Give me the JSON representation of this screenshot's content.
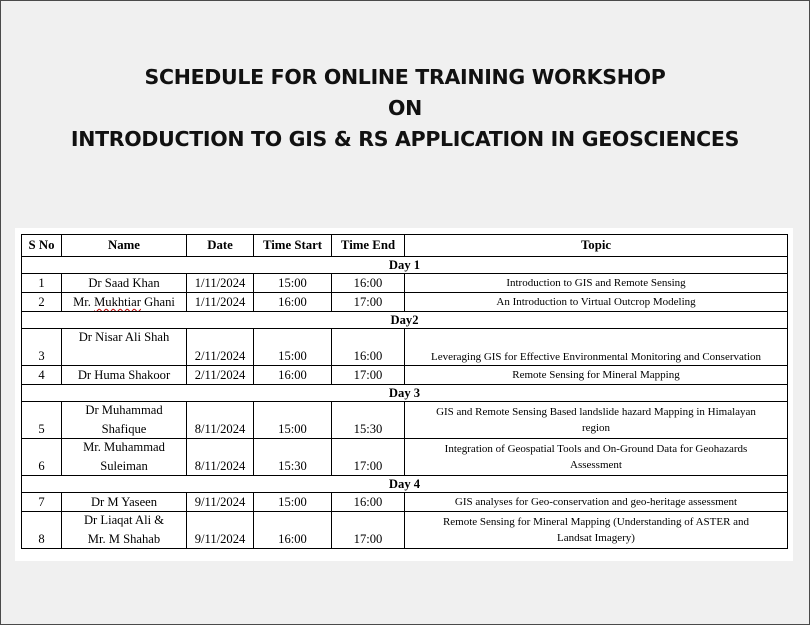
{
  "title": {
    "line1": "SCHEDULE FOR ONLINE TRAINING WORKSHOP",
    "line2": "ON",
    "line3": "INTRODUCTION TO GIS & RS APPLICATION IN GEOSCIENCES"
  },
  "table": {
    "headers": [
      "S No",
      "Name",
      "Date",
      "Time Start",
      "Time End",
      "Topic"
    ],
    "days": [
      "Day 1",
      "Day2",
      "Day 3",
      "Day 4"
    ],
    "rows": [
      {
        "sno": "1",
        "name": "Dr Saad Khan",
        "date": "1/11/2024",
        "start": "15:00",
        "end": "16:00",
        "topic": "Introduction to GIS and Remote Sensing"
      },
      {
        "sno": "2",
        "name_a": "Mr. ",
        "name_b": "Mukhtiar",
        "name_c": " Ghani",
        "date": "1/11/2024",
        "start": "16:00",
        "end": "17:00",
        "topic": "An Introduction to Virtual Outcrop Modeling"
      },
      {
        "sno": "3",
        "name": "Dr Nisar Ali Shah",
        "date": "2/11/2024",
        "start": "15:00",
        "end": "16:00",
        "topic": "Leveraging GIS for Effective Environmental Monitoring and Conservation"
      },
      {
        "sno": "4",
        "name": "Dr Huma Shakoor",
        "date": "2/11/2024",
        "start": "16:00",
        "end": "17:00",
        "topic": "Remote Sensing for Mineral Mapping"
      },
      {
        "sno": "5",
        "name_1": "Dr Muhammad",
        "name_2": "Shafique",
        "date": "8/11/2024",
        "start": "15:00",
        "end": "15:30",
        "topic_1": "GIS and Remote Sensing Based landslide hazard Mapping in Himalayan",
        "topic_2": "region"
      },
      {
        "sno": "6",
        "name_1": "Mr. Muhammad",
        "name_2": "Suleiman",
        "date": "8/11/2024",
        "start": "15:30",
        "end": "17:00",
        "topic_1": "Integration of Geospatial Tools and On-Ground Data for Geohazards",
        "topic_2": "Assessment"
      },
      {
        "sno": "7",
        "name": "Dr M Yaseen",
        "date": "9/11/2024",
        "start": "15:00",
        "end": "16:00",
        "topic": "GIS analyses for Geo-conservation and geo-heritage assessment"
      },
      {
        "sno": "8",
        "name_1": "Dr Liaqat Ali &",
        "name_2": "Mr. M Shahab",
        "date": "9/11/2024",
        "start": "16:00",
        "end": "17:00",
        "topic_1": "Remote Sensing for Mineral Mapping (Understanding of ASTER and",
        "topic_2": "Landsat Imagery)"
      }
    ]
  }
}
